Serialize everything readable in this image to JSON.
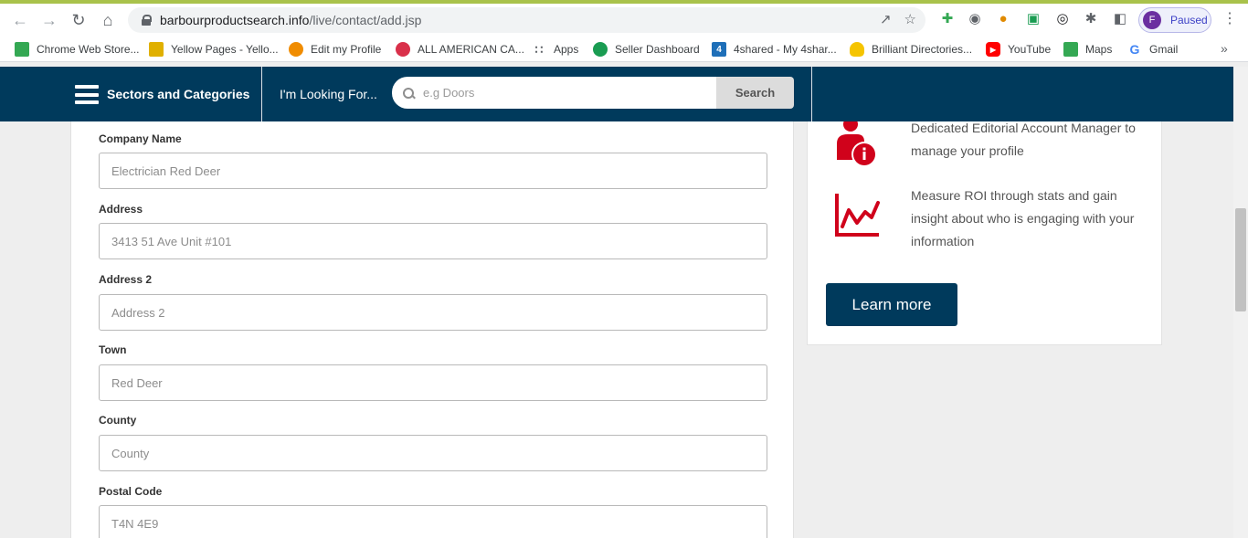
{
  "browser": {
    "url_domain": "barbourproductsearch.info",
    "url_path": "/live/contact/add.jsp",
    "profile_initial": "F",
    "profile_status": "Paused",
    "bookmarks": [
      {
        "label": "Chrome Web Store...",
        "icon": "chrome-web-store-icon",
        "color": "#34a853"
      },
      {
        "label": "Yellow Pages - Yello...",
        "icon": "yellow-pages-icon",
        "color": "#e0b000"
      },
      {
        "label": "Edit my Profile",
        "icon": "edit-profile-icon",
        "color": "#f08c00"
      },
      {
        "label": "ALL AMERICAN CA...",
        "icon": "all-american-icon",
        "color": "#d9304a"
      },
      {
        "label": "Apps",
        "icon": "apps-grid-icon",
        "color": "#5f6368"
      },
      {
        "label": "Seller Dashboard",
        "icon": "seller-dashboard-icon",
        "color": "#1a9c52"
      },
      {
        "label": "4shared - My 4shar...",
        "icon": "4shared-icon",
        "color": "#1e6fb8"
      },
      {
        "label": "Brilliant Directories...",
        "icon": "lightbulb-icon",
        "color": "#f5c400"
      },
      {
        "label": "YouTube",
        "icon": "youtube-icon",
        "color": "#ff0000"
      },
      {
        "label": "Maps",
        "icon": "maps-icon",
        "color": "#34a853"
      },
      {
        "label": "Gmail",
        "icon": "google-icon",
        "color": "#4285f4"
      }
    ]
  },
  "header": {
    "menu_label": "Sectors and Categories",
    "looking_label": "I'm Looking For...",
    "search_placeholder": "e.g Doors",
    "search_button": "Search",
    "color": "#003a5c"
  },
  "form": {
    "fields": [
      {
        "label": "Company Name",
        "placeholder": "Electrician Red Deer"
      },
      {
        "label": "Address",
        "placeholder": "3413 51 Ave Unit #101"
      },
      {
        "label": "Address 2",
        "placeholder": "Address 2"
      },
      {
        "label": "Town",
        "placeholder": "Red Deer"
      },
      {
        "label": "County",
        "placeholder": "County"
      },
      {
        "label": "Postal Code",
        "placeholder": "T4N 4E9"
      }
    ]
  },
  "sidebar": {
    "benefits": [
      {
        "icon": "account-manager-icon",
        "text": "Dedicated Editorial Account Manager to manage your profile"
      },
      {
        "icon": "stats-chart-icon",
        "text": "Measure ROI through stats and gain insight about who is engaging with your information"
      }
    ],
    "learn_more": "Learn more",
    "accent": "#d0021b"
  }
}
